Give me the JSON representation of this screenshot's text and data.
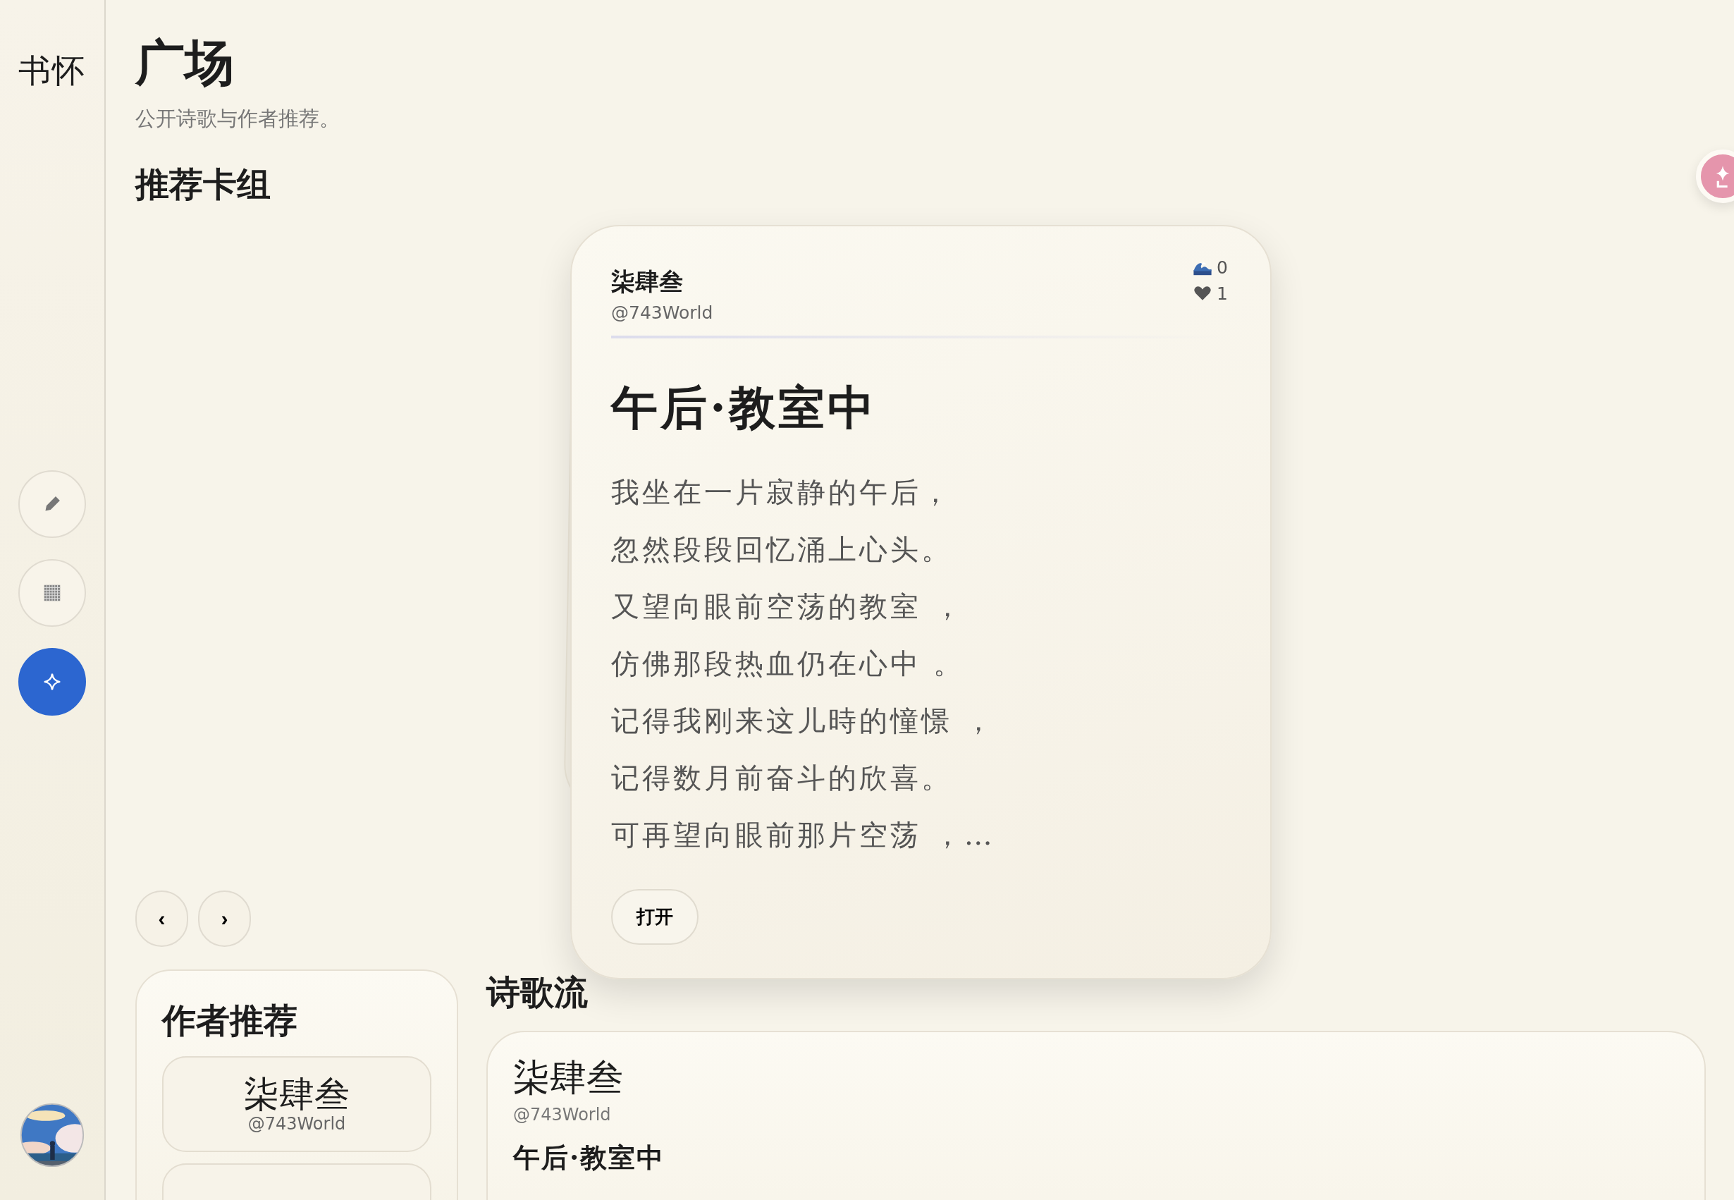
{
  "sidebar": {
    "logo": "书怀",
    "nav": [
      {
        "kind": "edit",
        "selected": false
      },
      {
        "kind": "grid",
        "selected": false
      },
      {
        "kind": "spark",
        "selected": true
      }
    ]
  },
  "page": {
    "title": "广场",
    "subtitle": "公开诗歌与作者推荐。"
  },
  "deck": {
    "heading": "推荐卡组",
    "card": {
      "author": "柒肆叁",
      "handle": "@743World",
      "stats": [
        {
          "kind": "wave",
          "count": "0"
        },
        {
          "kind": "heart",
          "count": "1"
        }
      ],
      "title": "午后·教室中",
      "lines": [
        "我坐在一片寂静的午后，",
        "忽然段段回忆涌上心头。",
        "又望向眼前空荡的教室 ，",
        "仿佛那段热血仍在心中 。",
        "记得我刚来这儿時的憧憬 ，",
        "记得数月前奋斗的欣喜。",
        "可再望向眼前那片空荡 ，…"
      ],
      "open_button": "打开"
    },
    "nav": [
      "‹",
      "›"
    ]
  },
  "authors": {
    "heading": "作者推荐",
    "items": [
      {
        "name": "柒肆叁",
        "handle": "@743World"
      }
    ]
  },
  "stream": {
    "heading": "诗歌流",
    "posts": [
      {
        "author": "柒肆叁",
        "handle": "@743World",
        "title": "午后·教室中"
      }
    ]
  }
}
